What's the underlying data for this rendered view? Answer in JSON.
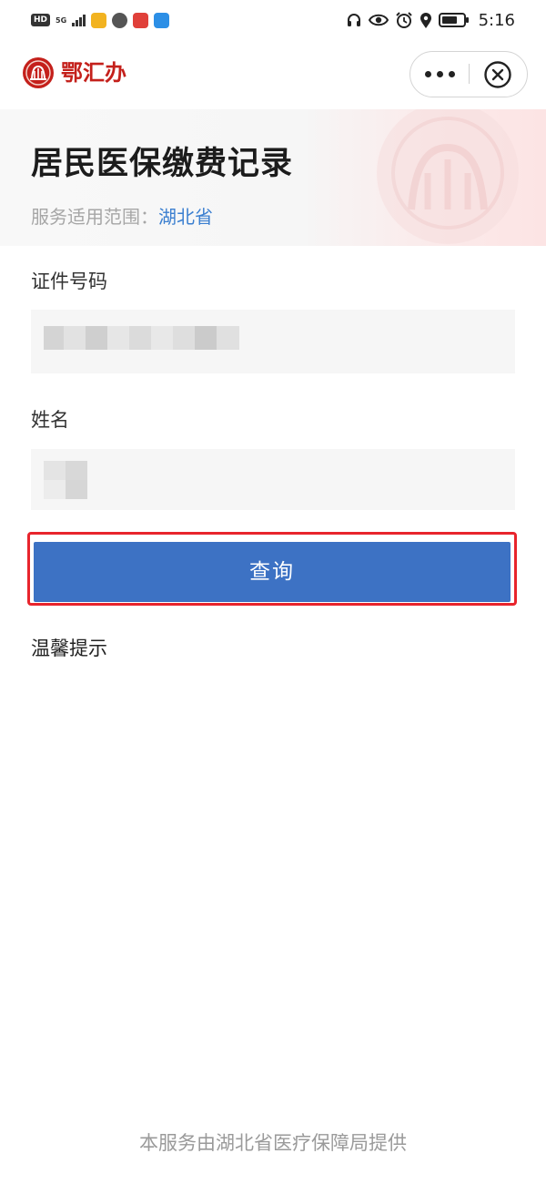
{
  "status_bar": {
    "hd_badge": "HD",
    "network": "5G",
    "time": "5:16",
    "app_icons": [
      {
        "name": "app-icon-yellow",
        "color": "#f2b320"
      },
      {
        "name": "app-icon-globe",
        "color": "#555555"
      },
      {
        "name": "app-icon-red",
        "color": "#e0403a"
      },
      {
        "name": "app-icon-blue",
        "color": "#2c8fe6"
      }
    ],
    "right_icons": [
      "headphones-icon",
      "eye-icon",
      "alarm-icon",
      "location-icon",
      "battery-icon"
    ]
  },
  "title_bar": {
    "app_name": "鄂汇办",
    "brand_color": "#c4201b",
    "more_icon": "more-dots-icon",
    "close_icon": "close-circle-icon"
  },
  "header": {
    "title": "居民医保缴费记录",
    "scope_label": "服务适用范围：",
    "scope_value": "湖北省"
  },
  "form": {
    "id_label": "证件号码",
    "name_label": "姓名",
    "query_button": "查询",
    "button_color": "#3d72c4",
    "highlight_color": "#e8242c"
  },
  "tips": {
    "title": "温馨提示"
  },
  "footer": {
    "note": "本服务由湖北省医疗保障局提供"
  }
}
